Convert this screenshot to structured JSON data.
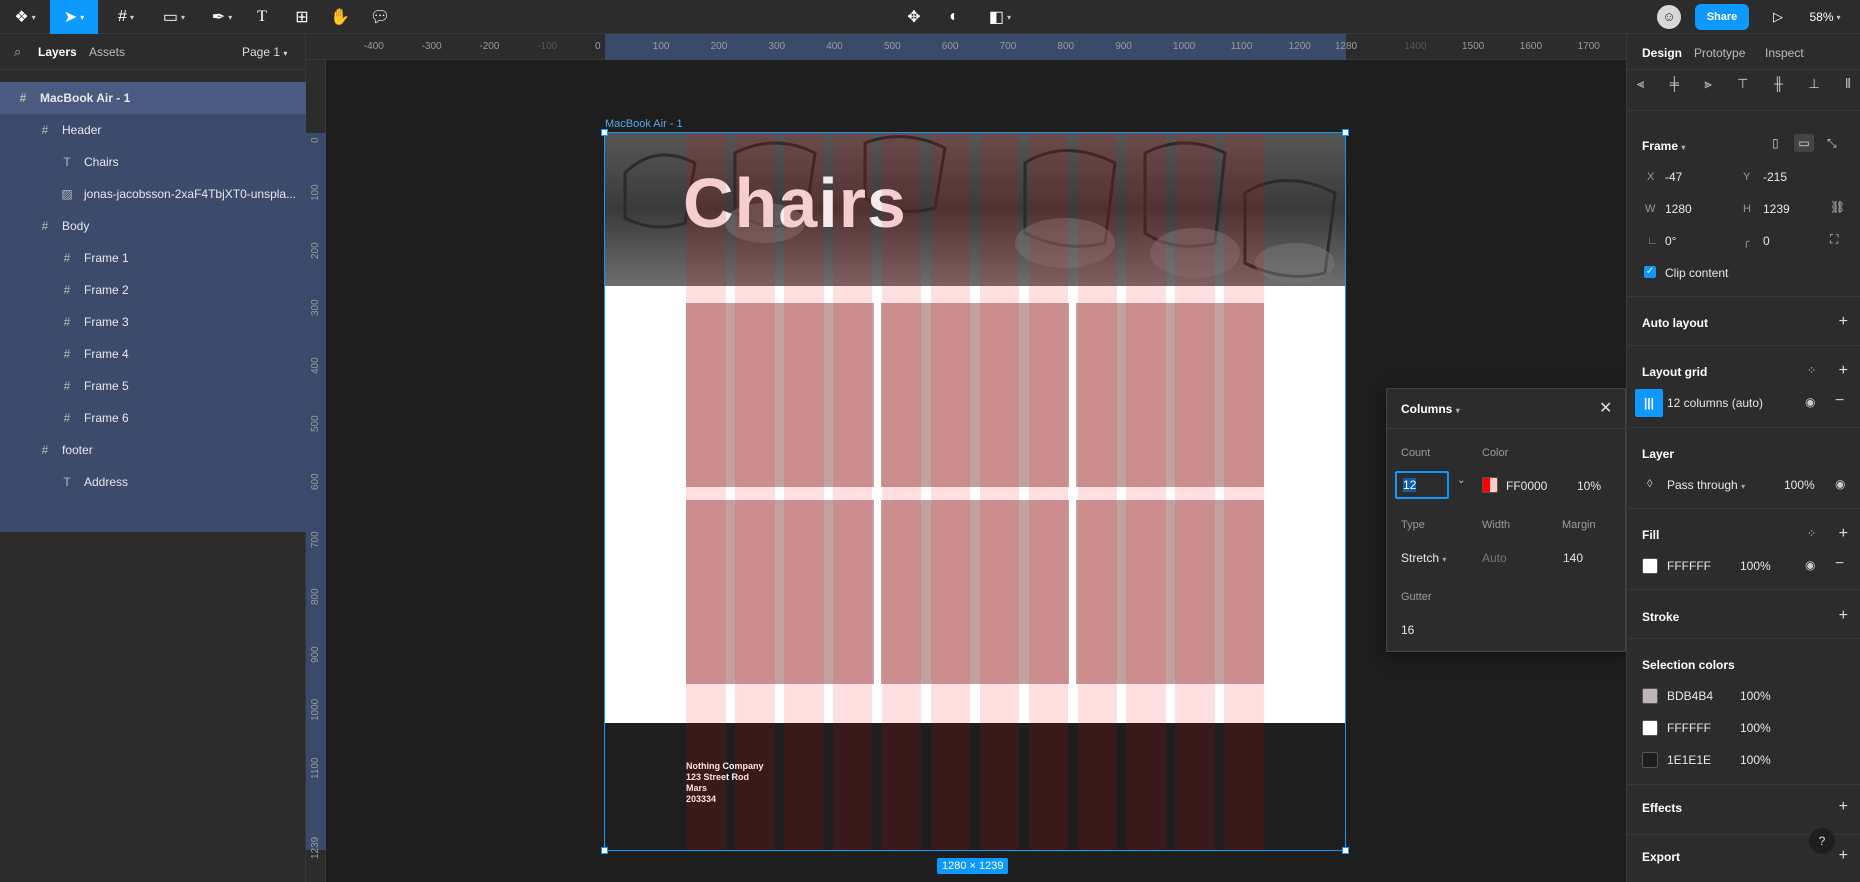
{
  "toolbar": {
    "zoom": "58%",
    "share_label": "Share"
  },
  "left_panel": {
    "tabs": [
      "Layers",
      "Assets"
    ],
    "page_label": "Page 1",
    "layers": [
      {
        "name": "MacBook Air - 1",
        "icon": "frame-icon",
        "depth": 0
      },
      {
        "name": "Header",
        "icon": "frame-icon",
        "depth": 1
      },
      {
        "name": "Chairs",
        "icon": "text-icon",
        "depth": 2
      },
      {
        "name": "jonas-jacobsson-2xaF4TbjXT0-unspla...",
        "icon": "image-icon",
        "depth": 2
      },
      {
        "name": "Body",
        "icon": "frame-icon",
        "depth": 1
      },
      {
        "name": "Frame 1",
        "icon": "frame-icon",
        "depth": 2
      },
      {
        "name": "Frame 2",
        "icon": "frame-icon",
        "depth": 2
      },
      {
        "name": "Frame 3",
        "icon": "frame-icon",
        "depth": 2
      },
      {
        "name": "Frame 4",
        "icon": "frame-icon",
        "depth": 2
      },
      {
        "name": "Frame 5",
        "icon": "frame-icon",
        "depth": 2
      },
      {
        "name": "Frame 6",
        "icon": "frame-icon",
        "depth": 2
      },
      {
        "name": "footer",
        "icon": "frame-icon",
        "depth": 1
      },
      {
        "name": "Address",
        "icon": "text-icon",
        "depth": 2
      }
    ]
  },
  "rulers": {
    "h_labels": [
      "-400",
      "-300",
      "-200",
      "-100",
      "0",
      "100",
      "200",
      "300",
      "400",
      "500",
      "600",
      "700",
      "800",
      "900",
      "1000",
      "1100",
      "1200",
      "1280",
      "1400",
      "1500",
      "1600",
      "1700"
    ],
    "v_labels": [
      "0",
      "100",
      "200",
      "300",
      "400",
      "500",
      "600",
      "700",
      "800",
      "900",
      "1000",
      "1100",
      "1239"
    ]
  },
  "canvas": {
    "frame_label": "MacBook Air - 1",
    "hero_title": "Chairs",
    "address_lines": [
      "Nothing Company",
      "123  Street Rod",
      "Mars",
      "203334"
    ],
    "size_badge": "1280 × 1239"
  },
  "grid_popup": {
    "title": "Columns",
    "count_label": "Count",
    "count_value": "12",
    "color_label": "Color",
    "color_hex": "FF0000",
    "color_opacity": "10%",
    "type_label": "Type",
    "type_value": "Stretch",
    "width_label": "Width",
    "width_value": "Auto",
    "margin_label": "Margin",
    "margin_value": "140",
    "gutter_label": "Gutter",
    "gutter_value": "16"
  },
  "right_panel": {
    "tabs": [
      "Design",
      "Prototype",
      "Inspect"
    ],
    "frame_title": "Frame",
    "x_label": "X",
    "x_value": "-47",
    "y_label": "Y",
    "y_value": "-215",
    "w_label": "W",
    "w_value": "1280",
    "h_label": "H",
    "h_value": "1239",
    "rotation": "0°",
    "radius": "0",
    "clip_content": "Clip content",
    "auto_layout": "Auto layout",
    "layout_grid": "Layout grid",
    "grid_item": "12 columns (auto)",
    "layer": "Layer",
    "blend_mode": "Pass through",
    "layer_opacity": "100%",
    "fill": "Fill",
    "fill_hex": "FFFFFF",
    "fill_opacity": "100%",
    "stroke": "Stroke",
    "selection_colors": "Selection colors",
    "colors": [
      {
        "hex": "BDB4B4",
        "opacity": "100%",
        "swatch": "#BDB4B4"
      },
      {
        "hex": "FFFFFF",
        "opacity": "100%",
        "swatch": "#FFFFFF"
      },
      {
        "hex": "1E1E1E",
        "opacity": "100%",
        "swatch": "#1E1E1E"
      }
    ],
    "effects": "Effects",
    "export": "Export"
  },
  "theme": {
    "accent": "#0d99ff",
    "grid_color": "#FF0000",
    "card_color": "#c4a1a1"
  }
}
